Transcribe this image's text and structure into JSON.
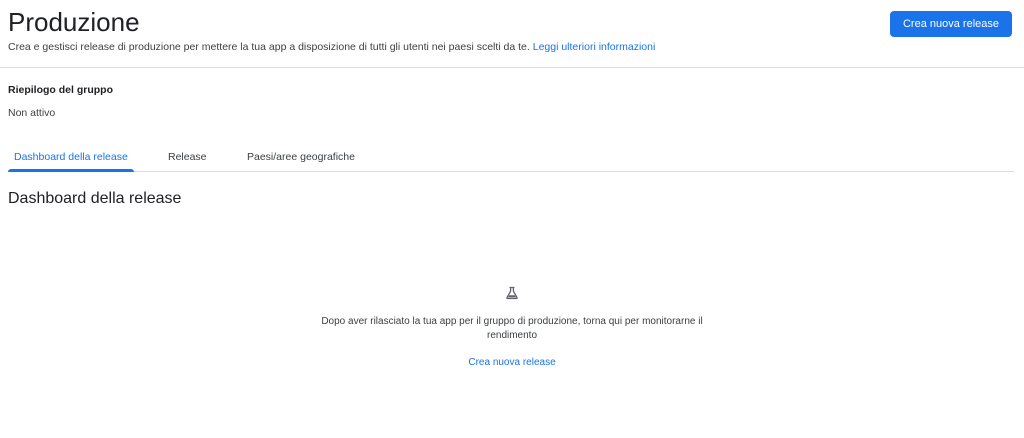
{
  "header": {
    "title": "Produzione",
    "subtitle": "Crea e gestisci release di produzione per mettere la tua app a disposizione di tutti gli utenti nei paesi scelti da te.",
    "learn_more": "Leggi ulteriori informazioni",
    "primary_button": "Crea nuova release"
  },
  "summary": {
    "label": "Riepilogo del gruppo",
    "value": "Non attivo"
  },
  "tabs": [
    {
      "label": "Dashboard della release",
      "active": true
    },
    {
      "label": "Release",
      "active": false
    },
    {
      "label": "Paesi/aree geografiche",
      "active": false
    }
  ],
  "section": {
    "title": "Dashboard della release"
  },
  "empty_state": {
    "icon": "flask-icon",
    "message": "Dopo aver rilasciato la tua app per il gruppo di produzione, torna qui per monitorarne il rendimento",
    "link": "Crea nuova release"
  },
  "colors": {
    "accent": "#1a73e8",
    "text": "#202124",
    "secondary_text": "#3c4043",
    "divider": "#dadce0"
  }
}
